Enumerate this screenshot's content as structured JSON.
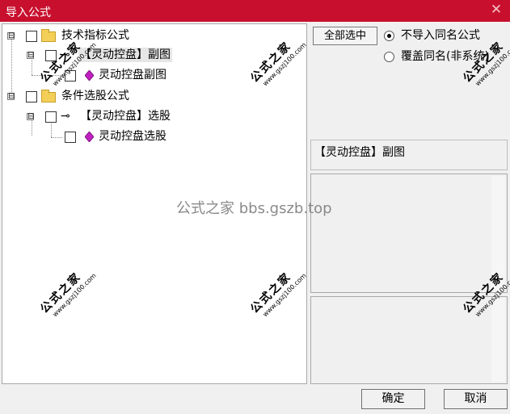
{
  "window": {
    "title": "导入公式",
    "close_glyph": "✕"
  },
  "tree": {
    "nodes": [
      {
        "id": "tech",
        "label": "技术指标公式",
        "icon": "folder-icon",
        "expander": "⊟"
      },
      {
        "id": "tech-group",
        "label": "【灵动控盘】副图",
        "icon": "key-icon",
        "expander": "⊟"
      },
      {
        "id": "tech-item",
        "label": "灵动控盘副图",
        "icon": "gem-icon"
      },
      {
        "id": "cond",
        "label": "条件选股公式",
        "icon": "folder-icon",
        "expander": "⊟"
      },
      {
        "id": "cond-group",
        "label": "【灵动控盘】选股",
        "icon": "key-icon",
        "expander": "⊟"
      },
      {
        "id": "cond-item",
        "label": "灵动控盘选股",
        "icon": "gem-icon"
      }
    ]
  },
  "options": {
    "select_all_label": "全部选中",
    "radio_no_import": "不导入同名公式",
    "radio_overwrite": "覆盖同名(非系统)",
    "selected_radio": "no_import"
  },
  "description": "【灵动控盘】副图",
  "buttons": {
    "ok": "确定",
    "cancel": "取消"
  },
  "watermark": {
    "center_text": "公式之家 bbs.gszb.top",
    "stamp_big": "公式之家",
    "stamp_small": "www.gszj100.com"
  },
  "colors": {
    "titlebar": "#c8102e",
    "gem": "#c020c0"
  }
}
